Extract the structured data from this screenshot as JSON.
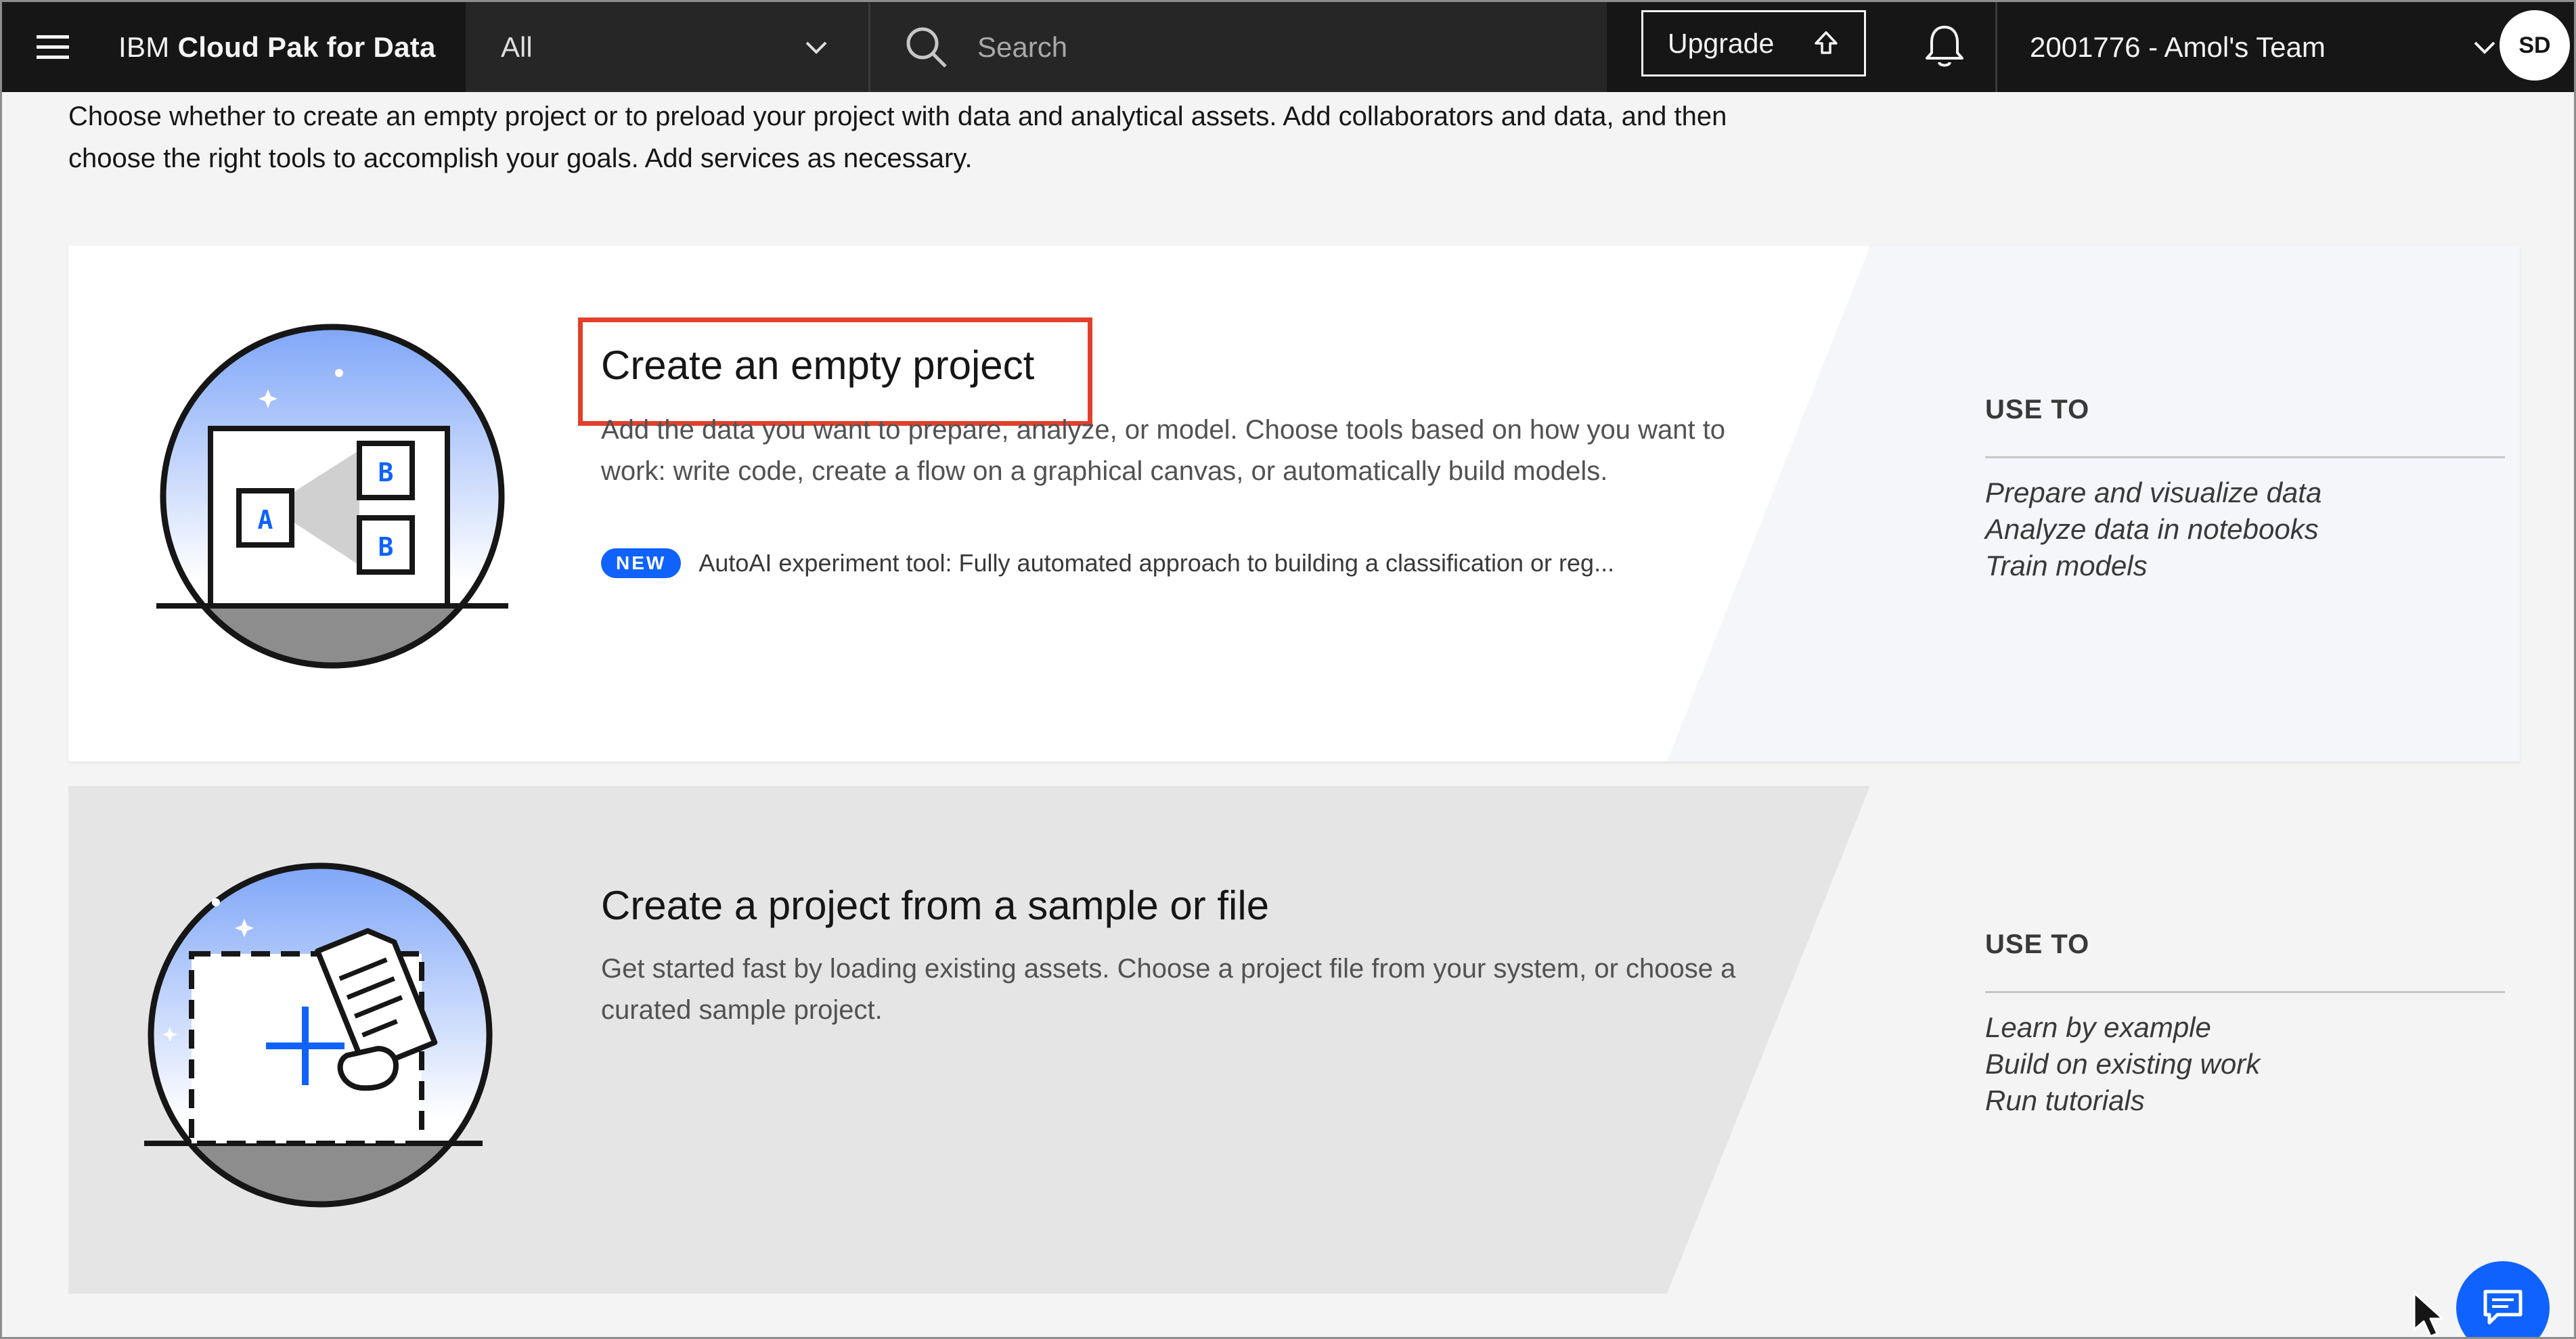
{
  "header": {
    "brand_prefix": "IBM",
    "brand_name": "Cloud Pak for Data",
    "scope_selected": "All",
    "search_placeholder": "Search",
    "upgrade_label": "Upgrade",
    "account_label": "2001776 - Amol's Team",
    "avatar_initials": "SD"
  },
  "intro": {
    "text": "Choose whether to create an empty project or to preload your project with data and analytical assets. Add collaborators and data, and then choose the right tools to accomplish your goals. Add services as necessary."
  },
  "cards": [
    {
      "title": "Create an empty project",
      "description": "Add the data you want to prepare, analyze, or model. Choose tools based on how you want to work: write code, create a flow on a graphical canvas, or automatically build models.",
      "badge": "NEW",
      "badge_text": "AutoAI experiment tool: Fully automated approach to building a classification or reg...",
      "use_to_label": "USE TO",
      "use_to_items": [
        "Prepare and visualize data",
        "Analyze data in notebooks",
        "Train models"
      ]
    },
    {
      "title": "Create a project from a sample or file",
      "description": "Get started fast by loading existing assets. Choose a project file from your system, or choose a curated sample project.",
      "use_to_label": "USE TO",
      "use_to_items": [
        "Learn by example",
        "Build on existing work",
        "Run tutorials"
      ]
    }
  ],
  "illustration_letters": {
    "a": "A",
    "b": "B"
  },
  "colors": {
    "topbar": "#161616",
    "accent": "#0f62fe",
    "highlight_box": "#e3402c",
    "sky_top": "#7fa6f8",
    "sky_bottom": "#ffffff"
  },
  "icons": [
    "hamburger-menu-icon",
    "chevron-down-icon",
    "search-icon",
    "upgrade-arrow-icon",
    "notification-bell-icon",
    "chat-icon",
    "mouse-cursor-icon"
  ]
}
